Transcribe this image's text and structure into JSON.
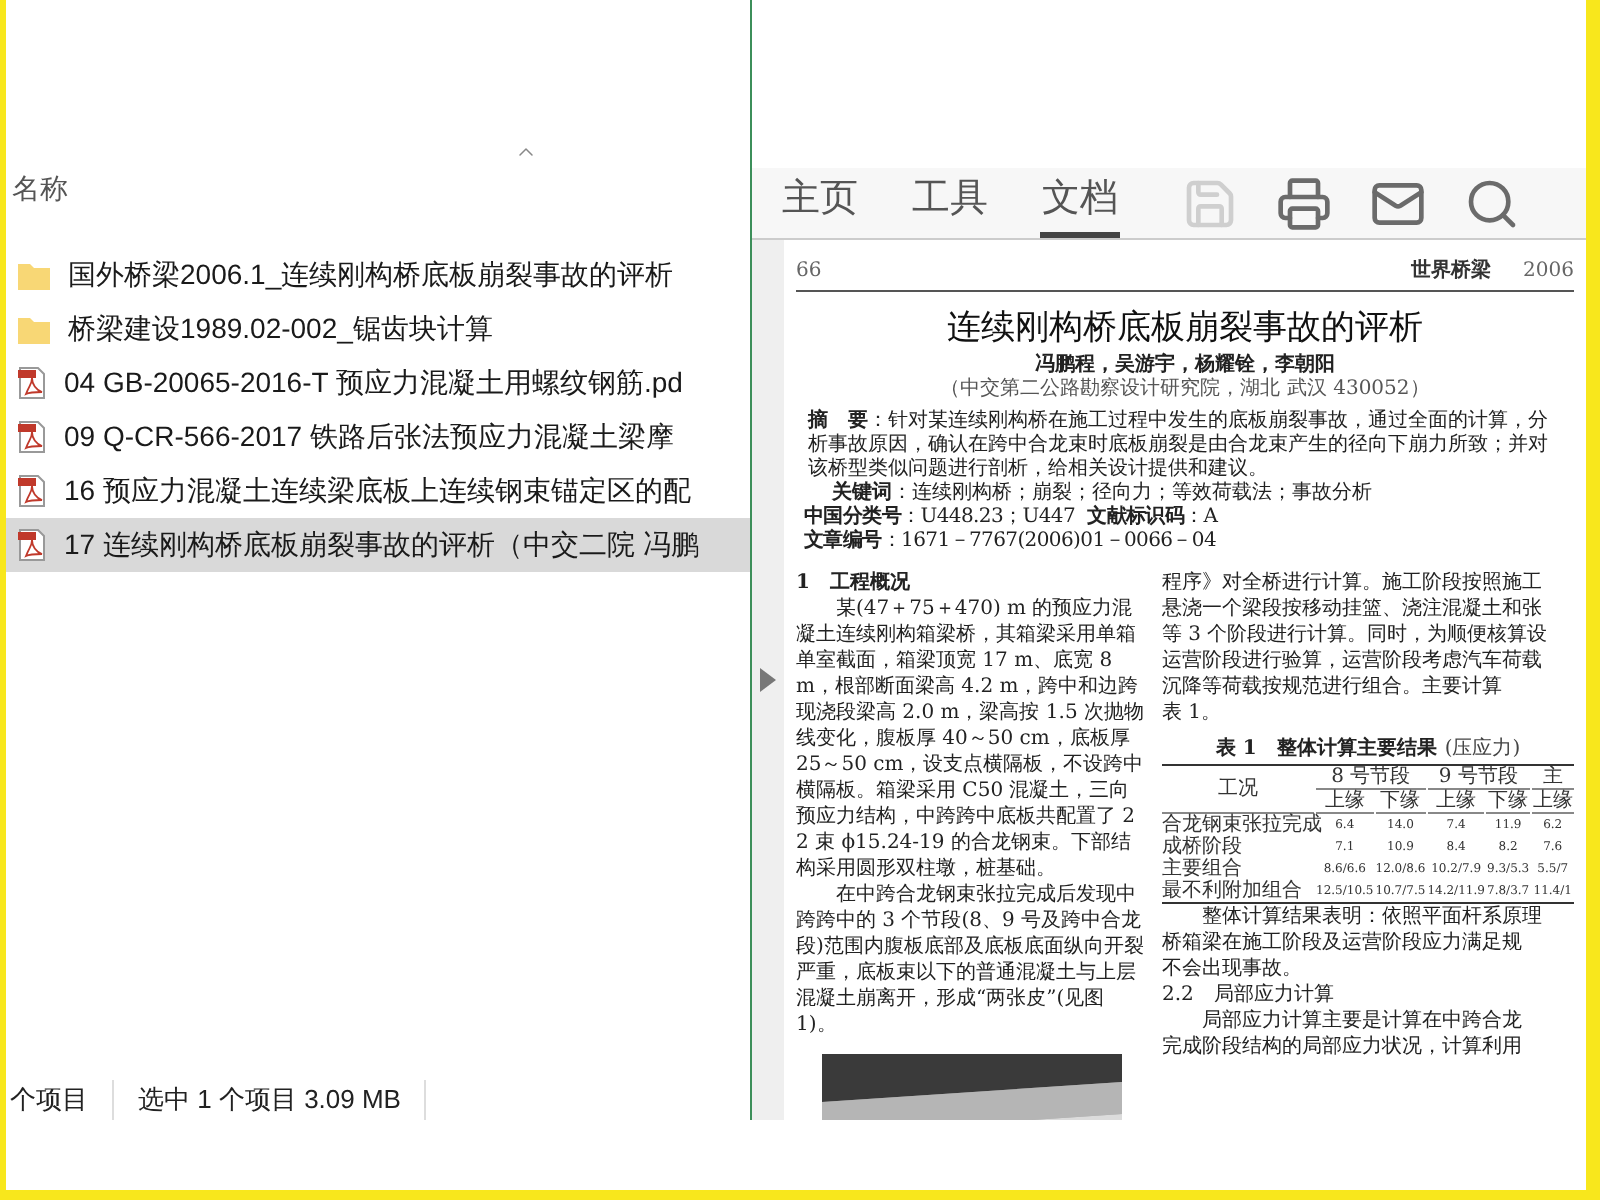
{
  "explorer": {
    "column_header": "名称",
    "files": [
      {
        "name": "国外桥梁2006.1_连续刚构桥底板崩裂事故的评析",
        "kind": "folder",
        "selected": false
      },
      {
        "name": "桥梁建设1989.02-002_锯齿块计算",
        "kind": "folder",
        "selected": false
      },
      {
        "name": "04 GB-20065-2016-T 预应力混凝土用螺纹钢筋.pd",
        "kind": "pdf",
        "selected": false
      },
      {
        "name": "09 Q-CR-566-2017 铁路后张法预应力混凝土梁摩",
        "kind": "pdf",
        "selected": false
      },
      {
        "name": "16 预应力混凝土连续梁底板上连续钢束锚定区的配",
        "kind": "pdf",
        "selected": false
      },
      {
        "name": "17 连续刚构桥底板崩裂事故的评析（中交二院 冯鹏",
        "kind": "pdf",
        "selected": true
      }
    ],
    "status_bar": [
      "个项目",
      "选中 1 个项目 3.09 MB"
    ]
  },
  "preview": {
    "tabs": [
      {
        "label": "主页",
        "selected": false
      },
      {
        "label": "工具",
        "selected": false
      },
      {
        "label": "文档",
        "selected": true
      }
    ],
    "toolbar": [
      {
        "kind": "save",
        "disabled": true
      },
      {
        "kind": "print",
        "disabled": false
      },
      {
        "kind": "mail",
        "disabled": false
      },
      {
        "kind": "search",
        "disabled": false
      }
    ],
    "page": {
      "page_number": "66",
      "journal": "世界桥梁",
      "year": "2006",
      "title": "连续刚构桥底板崩裂事故的评析",
      "authors": "冯鹏程，吴游宇，杨耀铨，李朝阳",
      "affiliation": "（中交第二公路勘察设计研究院，湖北 武汉 430052）",
      "abstract": "**摘　要**：针对某连续刚构桥在施工过程中发生的底板崩裂事故，通过全面的计算，分析事故原因，确认在跨中合龙束时底板崩裂是由合龙束产生的径向下崩力所致；并对该桥型类似问题进行剖析，给相关设计提供和建议。",
      "keywords": "**关键词**：连续刚构桥；崩裂；径向力；等效荷载法；事故分析",
      "classification": [
        "**中国分类号**：U448.23；U447",
        "**文献标识码**：A",
        "**文章编号**：1671－7767(2006)01－0066－04"
      ],
      "left_column": {
        "heading": "1　工程概况",
        "paragraphs": [
          "某(47＋75＋470) m 的预应力混凝土连续刚构箱梁桥，其箱梁采用单箱单室截面，箱梁顶宽 17 m、底宽 8 m，根部断面梁高 4.2 m，跨中和边跨现浇段梁高 2.0 m，梁高按 1.5 次抛物线变化，腹板厚 40～50 cm，底板厚 25～50 cm，设支点横隔板，不设跨中横隔板。箱梁采用 C50 混凝土，三向预应力结构，中跨跨中底板共配置了 22 束 ϕ15.24-19 的合龙钢束。下部结构采用圆形双柱墩，桩基础。",
          "在中跨合龙钢束张拉完成后发现中跨跨中的 3 个节段(8、9 号及跨中合龙段)范围内腹板底部及底板底面纵向开裂严重，底板束以下的普通混凝土与上层混凝土崩离开，形成“两张皮”(见图 1)。"
        ],
        "figure": {
          "kind": "picture"
        }
      },
      "right_column": [
        {
          "kind": "line",
          "text": "程序》对全桥进行计算。施工阶段按照施工"
        },
        {
          "kind": "line",
          "text": "悬浇一个梁段按移动挂篮、浇注混凝土和张"
        },
        {
          "kind": "line",
          "text": "等 3 个阶段进行计算。同时，为顺便核算设"
        },
        {
          "kind": "line",
          "text": "运营阶段进行验算，运营阶段考虑汽车荷载"
        },
        {
          "kind": "line",
          "text": "沉降等荷载按规范进行组合。主要计算"
        },
        {
          "kind": "line",
          "text": "表 1。"
        },
        {
          "kind": "table",
          "title": "表 1　整体计算主要结果",
          "unit": "(压应力)",
          "row_header": "工况",
          "groups": [
            {
              "label": "8 号节段",
              "subheaders": [
                "上缘",
                "下缘"
              ]
            },
            {
              "label": "9 号节段",
              "subheaders": [
                "上缘",
                "下缘"
              ]
            },
            {
              "label": "主",
              "subheaders": [
                "上缘"
              ]
            }
          ],
          "rows": [
            {
              "label": "合龙钢束张拉完成",
              "values": [
                "6.4",
                "14.0",
                "7.4",
                "11.9",
                "6.2"
              ]
            },
            {
              "label": "成桥阶段",
              "values": [
                "7.1",
                "10.9",
                "8.4",
                "8.2",
                "7.6"
              ]
            },
            {
              "label": "主要组合",
              "values": [
                "8.6/6.6",
                "12.0/8.6",
                "10.2/7.9",
                "9.3/5.3",
                "5.5/7"
              ]
            },
            {
              "label": "最不利附加组合",
              "values": [
                "12.5/10.5",
                "10.7/7.5",
                "14.2/11.9",
                "7.8/3.7",
                "11.4/1"
              ]
            }
          ]
        },
        {
          "kind": "indent",
          "text": "整体计算结果表明：依照平面杆系原理"
        },
        {
          "kind": "line",
          "text": "桥箱梁在施工阶段及运营阶段应力满足规"
        },
        {
          "kind": "line",
          "text": "不会出现事故。"
        },
        {
          "kind": "heading",
          "text": "2.2　局部应力计算"
        },
        {
          "kind": "indent",
          "text": "局部应力计算主要是计算在中跨合龙"
        },
        {
          "kind": "line",
          "text": "完成阶段结构的局部应力状况，计算利用"
        }
      ]
    }
  }
}
